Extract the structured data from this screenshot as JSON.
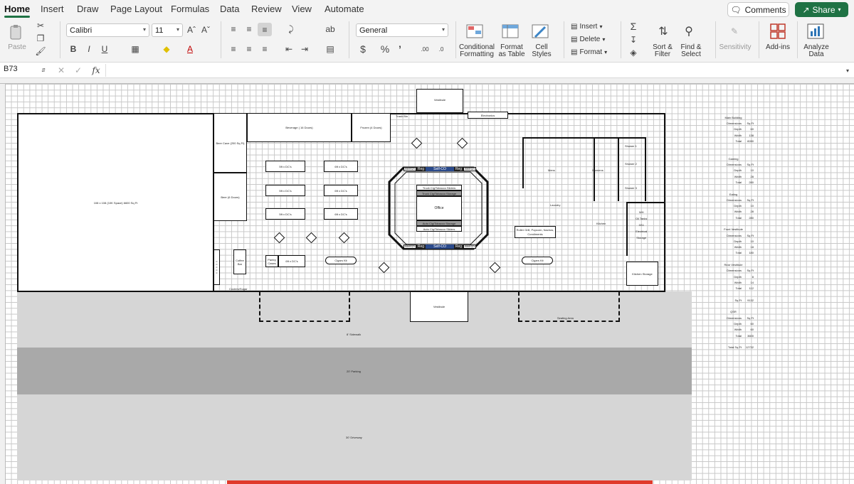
{
  "ribbon_tabs": [
    "Home",
    "Insert",
    "Draw",
    "Page Layout",
    "Formulas",
    "Data",
    "Review",
    "View",
    "Automate"
  ],
  "actions": {
    "comments": "Comments",
    "share": "Share"
  },
  "clipboard": {
    "paste": "Paste"
  },
  "font": {
    "name": "Calibri",
    "size": "11"
  },
  "number_format": "General",
  "styles": {
    "conditional": [
      "Conditional",
      "Formatting"
    ],
    "format_table": [
      "Format",
      "as Table"
    ],
    "cell_styles": [
      "Cell",
      "Styles"
    ]
  },
  "cells": {
    "insert": "Insert",
    "delete": "Delete",
    "format": "Format"
  },
  "editing": {
    "sort": [
      "Sort &",
      "Filter"
    ],
    "find": [
      "Find &",
      "Select"
    ]
  },
  "sensitivity": "Sensitivity",
  "addins": "Add-ins",
  "analyze": [
    "Analyze",
    "Data"
  ],
  "name_box": "B73",
  "formula_fx": "fx",
  "floorplan": {
    "building": "Main Building",
    "large_room": "108 x 108 (10K Space) 6600 Sq Ft",
    "beer_cave": "Beer Cave (200 Sq Ft)",
    "beer_doors": "Beer (6 Doors)",
    "beverage": "Beverage ( 16 Doors)",
    "frozen": "Frozen (4 Doors)",
    "trash_bin": "Trash Bin",
    "vestibule_top": "Vestibule",
    "electronics": "Electronics",
    "gondolas": [
      "5ft x DC's",
      "6ft x DC's",
      "5ft x DC's",
      "6ft x DC's",
      "5ft x DC's",
      "6ft x DC's"
    ],
    "office": "Office",
    "truck_sliders": "Truck Cig/Tobacco Sliders",
    "truck_storage": "Truck Cig/Tobacco Storage",
    "auto_storage": "Auto Cig/Tobacco Storage",
    "auto_sliders": "Auto Cig/Tobacco Sliders",
    "counter_labels": [
      "Merch",
      "Reg",
      "Self-CO",
      "Reg",
      "Merch"
    ],
    "mens": "Mens",
    "womens": "Womens",
    "showers": [
      "Shower 1",
      "Shower 2",
      "Shower 3"
    ],
    "laundry": "Laundry",
    "kitchen": "Kitchen",
    "wh_lines": [
      "WH",
      "Oil Tanks",
      "3/11",
      "Electrical",
      "Storage"
    ],
    "roller_grill": [
      "Roller Grill, Popcorn, Nachos,",
      "Condiments"
    ],
    "kitchen_storage": "Kitchen Storage",
    "pantry": "Pantry Cases",
    "coffee": "Coffee Bar",
    "cases_tags": [
      "C",
      "C",
      "C",
      "C",
      "C"
    ],
    "gondola_low": "6ft x DC's",
    "cigars": [
      "Cigars Kit",
      "Cigars Kit"
    ],
    "coolers": "Coolers/Sugar",
    "vestibule_bottom": "Vestibule",
    "seating": "Seating Area",
    "sidewalk": "8' Sidewalk",
    "parking": "20' Parking",
    "driveway": "30' Driveway"
  },
  "dimensions": [
    {
      "title": "Main Building",
      "rows": [
        [
          "Dimensions",
          "Sq Ft"
        ],
        [
          "Depth",
          "60"
        ],
        [
          "Width",
          "138"
        ],
        [
          "Total",
          "8280"
        ]
      ]
    },
    {
      "title": "Gaming",
      "rows": [
        [
          "Dimensions",
          "Sq Ft"
        ],
        [
          "Depth",
          "10"
        ],
        [
          "Width",
          "28"
        ],
        [
          "Total",
          "280"
        ]
      ]
    },
    {
      "title": "Eating",
      "rows": [
        [
          "Dimensions",
          "Sq Ft"
        ],
        [
          "Depth",
          "10"
        ],
        [
          "Width",
          "28"
        ],
        [
          "Total",
          "280"
        ]
      ]
    },
    {
      "title": "Front Vestibule",
      "rows": [
        [
          "Dimensions",
          "Sq Ft"
        ],
        [
          "Depth",
          "10"
        ],
        [
          "Width",
          "18"
        ],
        [
          "Total",
          "180"
        ]
      ]
    },
    {
      "title": "Rear Vestibule",
      "rows": [
        [
          "Dimensions",
          "Sq Ft"
        ],
        [
          "Depth",
          "8"
        ],
        [
          "Width",
          "14"
        ],
        [
          "Total",
          "112"
        ]
      ]
    },
    {
      "title": "",
      "rows": [
        [
          "Sq Ft",
          "9132"
        ]
      ]
    },
    {
      "title": "QSR",
      "rows": [
        [
          "Dimensions",
          "Sq Ft"
        ],
        [
          "Depth",
          "60"
        ],
        [
          "Width",
          "60"
        ],
        [
          "Total",
          "3600"
        ]
      ]
    },
    {
      "title": "",
      "rows": [
        [
          "Total Sq Ft",
          "12732"
        ]
      ]
    }
  ]
}
